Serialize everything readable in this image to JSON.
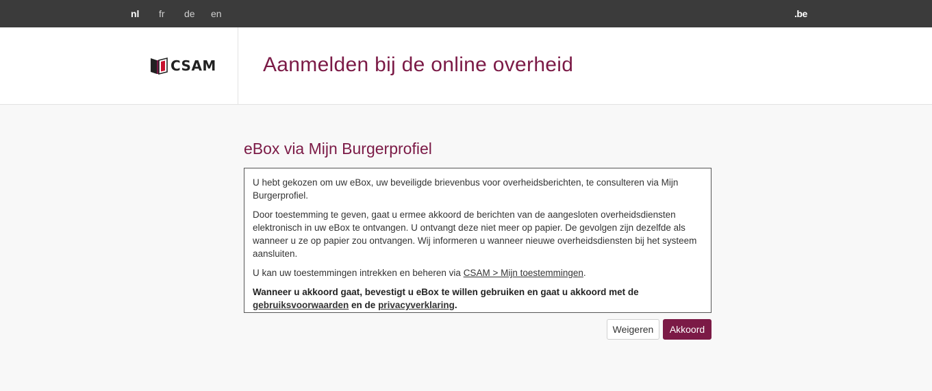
{
  "topbar": {
    "languages": [
      {
        "code": "nl",
        "active": true
      },
      {
        "code": "fr",
        "active": false
      },
      {
        "code": "de",
        "active": false
      },
      {
        "code": "en",
        "active": false
      }
    ],
    "domain_label": ".be"
  },
  "header": {
    "logo_text": "CSAM",
    "title": "Aanmelden bij de online overheid"
  },
  "main": {
    "section_title": "eBox via Mijn Burgerprofiel",
    "para1": "U hebt gekozen om uw eBox, uw beveiligde brievenbus voor overheidsberichten, te consulteren via Mijn Burgerprofiel.",
    "para2": "Door toestemming te geven, gaat u ermee akkoord de berichten van de aangesloten overheidsdiensten elektronisch in uw eBox te ontvangen. U ontvangt deze niet meer op papier. De gevolgen zijn dezelfde als wanneer u ze op papier zou ontvangen. Wij informeren u wanneer nieuwe overheidsdiensten bij het systeem aansluiten.",
    "para3_prefix": "U kan uw toestemmingen intrekken en beheren via ",
    "para3_link": "CSAM > Mijn toestemmingen",
    "para3_suffix": ".",
    "para4_prefix": "Wanneer u akkoord gaat, bevestigt u eBox te willen gebruiken en gaat u akkoord met de ",
    "para4_link1": "gebruiksvoorwaarden",
    "para4_mid": " en de ",
    "para4_link2": "privacyverklaring",
    "para4_suffix": "."
  },
  "buttons": {
    "refuse_label": "Weigeren",
    "accept_label": "Akkoord"
  },
  "colors": {
    "brand": "#7b1a46",
    "topbar": "#3b3b3b"
  }
}
